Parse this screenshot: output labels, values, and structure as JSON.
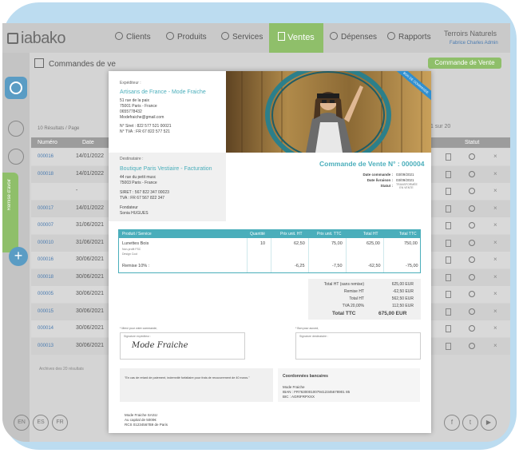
{
  "app": {
    "logo_text": "iabako",
    "company": "Terroirs Naturels",
    "user": "Fabrice Charles Admin",
    "nav": [
      {
        "label": "Clients",
        "icon": "user-icon"
      },
      {
        "label": "Produits",
        "icon": "tag-icon"
      },
      {
        "label": "Services",
        "icon": "briefcase-icon"
      },
      {
        "label": "Ventes",
        "icon": "document-icon",
        "active": true
      },
      {
        "label": "Dépenses",
        "icon": "wallet-icon"
      },
      {
        "label": "Rapports",
        "icon": "chart-icon"
      }
    ],
    "sidebar_green_label": "Remise d'avoir"
  },
  "list": {
    "title": "Commandes de ve",
    "new_button": "Commande de Vente",
    "results": "10  Résultats / Page",
    "pager": "1 sur 20",
    "headers": {
      "numero": "Numéro",
      "date": "Date",
      "statut": "Statut"
    },
    "rows": [
      {
        "num": "000016",
        "date": "14/01/2022"
      },
      {
        "num": "000018",
        "date": "14/01/2022"
      },
      {
        "num": "",
        "date": "-"
      },
      {
        "num": "000017",
        "date": "14/01/2022"
      },
      {
        "num": "000007",
        "date": "31/06/2021"
      },
      {
        "num": "000010",
        "date": "31/06/2021"
      },
      {
        "num": "000016",
        "date": "30/06/2021"
      },
      {
        "num": "000018",
        "date": "30/06/2021"
      },
      {
        "num": "000005",
        "date": "30/06/2021"
      },
      {
        "num": "000015",
        "date": "30/06/2021"
      },
      {
        "num": "000014",
        "date": "30/06/2021"
      },
      {
        "num": "000013",
        "date": "30/06/2021"
      }
    ],
    "archives": "Archives des 20 résultats"
  },
  "footer": {
    "langs": [
      "EN",
      "ES",
      "FR"
    ],
    "social": [
      "f",
      "t",
      "▶"
    ]
  },
  "invoice": {
    "expediteur_label": "Expéditeur :",
    "expediteur_name": "Artisans de France - Mode Fraiche",
    "expediteur_address": [
      "51 rue de la paix",
      "75001 Paris - France",
      "0655778432",
      "Modefraiche@gmail.com"
    ],
    "expediteur_siret": "N° Siret : 822 577 521 00021",
    "expediteur_tva": "N° TVA : FR 67 822 577 521",
    "ribbon": "BON DE COMMANDE",
    "destinataire_label": "Destinataire :",
    "destinataire_name": "Boutique Paris Vestiaire - Facturation",
    "destinataire_address": [
      "44 rue du petit musc",
      "75003 Paris - France"
    ],
    "destinataire_siret": "SIRET : 567 822 347 00023",
    "destinataire_tva": "TVA : FR 67 567 822 347",
    "destinataire_contact": [
      "Fondateur",
      "Sonia HUGUES"
    ],
    "order_title": "Commande de Vente N° : 000004",
    "meta_labels": [
      "Date commande :",
      "Date livraison :",
      "Statut :"
    ],
    "meta_values": [
      "03/09/2021",
      "03/09/2021"
    ],
    "status_value": "TRANSFORMÉE EN VENTE",
    "table_headers": [
      "Produit / Service",
      "Quantité",
      "Prix unit. HT",
      "Prix unit. TTC",
      "Total HT",
      "Total TTC"
    ],
    "line1": {
      "name": "Lunettes Bois",
      "sub1": "Non-profit FSC",
      "sub2": "Design Cool",
      "qty": "10",
      "pu_ht": "62,50",
      "pu_ttc": "75,00",
      "total_ht": "625,00",
      "total_ttc": "750,00"
    },
    "line2": {
      "name": "Remise 10% :",
      "pu_ht": "-6,25",
      "pu_ttc": "-7,50",
      "total_ht": "-62,50",
      "total_ttc": "-75,00"
    },
    "totals": [
      {
        "label": "Total HT (sans remise)",
        "value": "625,00 EUR"
      },
      {
        "label": "Remise HT",
        "value": "-62,50 EUR"
      },
      {
        "label": "Total HT",
        "value": "562,50 EUR"
      },
      {
        "label": "TVA 20,00%",
        "value": "112,50 EUR"
      }
    ],
    "total_ttc_label": "Total TTC",
    "total_ttc_value": "675,00 EUR",
    "sig_left_label": "* Merci pour votre commande,",
    "sig_left_inner": "Signature expéditeur :",
    "sig_left_script": "Mode Fraiche",
    "sig_right_label": "* Bon pour accord,",
    "sig_right_inner": "Signature destinataire :",
    "penalty_text": "\"En cas de retard de paiement, indemnité forfaitaire pour frais de recouvrement de 40 euros.\"",
    "bank_title": "Coordonnées bancaires",
    "bank_lines": [
      "Mode Fraiche",
      "IBAN : FR76300010079412345678901 85",
      "BIC : AGRIFRPXXX"
    ],
    "legal_lines": [
      "Mode Fraiche SASU",
      "Au capital de 5000€",
      "RCS 01234567B9 de Paris"
    ]
  }
}
